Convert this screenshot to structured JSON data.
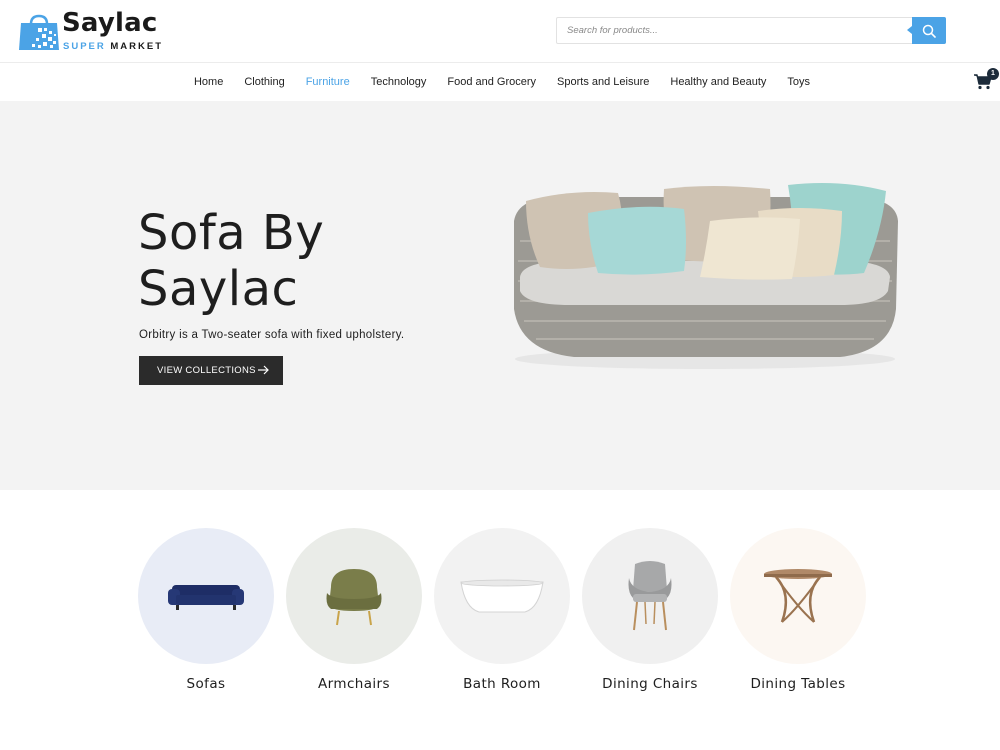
{
  "logo": {
    "title": "Saylac",
    "sub_accent": "SUPER",
    "sub_main": "MARKET"
  },
  "search": {
    "placeholder": "Search for products..."
  },
  "nav": {
    "items": [
      {
        "label": "Home"
      },
      {
        "label": "Clothing"
      },
      {
        "label": "Furniture"
      },
      {
        "label": "Technology"
      },
      {
        "label": "Food and Grocery"
      },
      {
        "label": "Sports and Leisure"
      },
      {
        "label": "Healthy and Beauty"
      },
      {
        "label": "Toys"
      }
    ],
    "active": "Furniture",
    "cart_count": "1"
  },
  "hero": {
    "title_line1": "Sofa By",
    "title_line2": "Saylac",
    "subtitle": "Orbitry is a Two-seater sofa with fixed upholstery.",
    "button_label": "VIEW COLLECTIONS"
  },
  "categories": [
    {
      "label": "Sofas",
      "icon": "sofa-icon",
      "bg": "#e8ecf6"
    },
    {
      "label": "Armchairs",
      "icon": "armchair-icon",
      "bg": "#eaece8"
    },
    {
      "label": "Bath Room",
      "icon": "bathtub-icon",
      "bg": "#f2f2f2"
    },
    {
      "label": "Dining Chairs",
      "icon": "dining-chair-icon",
      "bg": "#f0f0f0"
    },
    {
      "label": "Dining Tables",
      "icon": "dining-table-icon",
      "bg": "#fcf7f2"
    }
  ],
  "colors": {
    "accent": "#4ba3e6",
    "dark": "#2b2b2b",
    "hero_bg": "#f3f3f3"
  }
}
